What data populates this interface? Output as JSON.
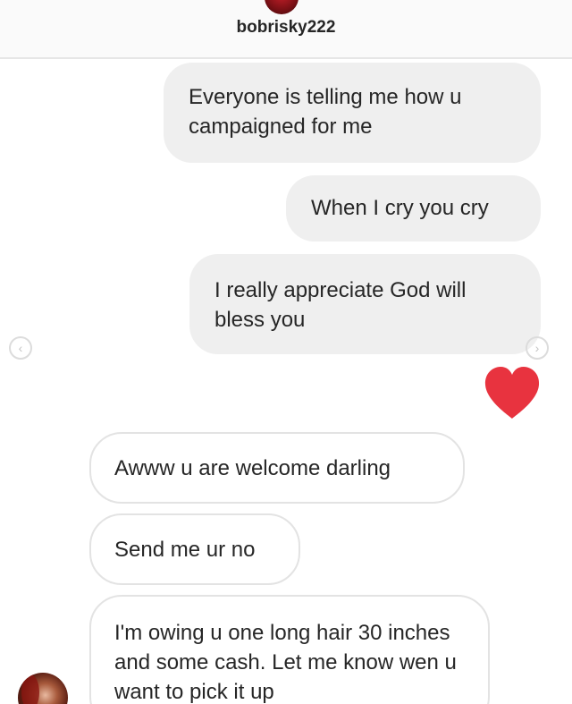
{
  "header": {
    "username": "bobrisky222"
  },
  "messages_out": [
    {
      "text": "Everyone is telling me how u campaigned for me"
    },
    {
      "text": "When I cry you cry"
    },
    {
      "text": "I really appreciate God will bless you"
    }
  ],
  "reaction": {
    "icon": "heart-icon",
    "color": "#ed4956"
  },
  "messages_in": [
    {
      "text": "Awww u are welcome darling"
    },
    {
      "text": "Send me ur no"
    },
    {
      "text": "I'm owing u one long hair 30 inches and some cash. Let me know wen u want to pick it up"
    }
  ],
  "nav": {
    "prev_glyph": "‹",
    "next_glyph": "›"
  }
}
